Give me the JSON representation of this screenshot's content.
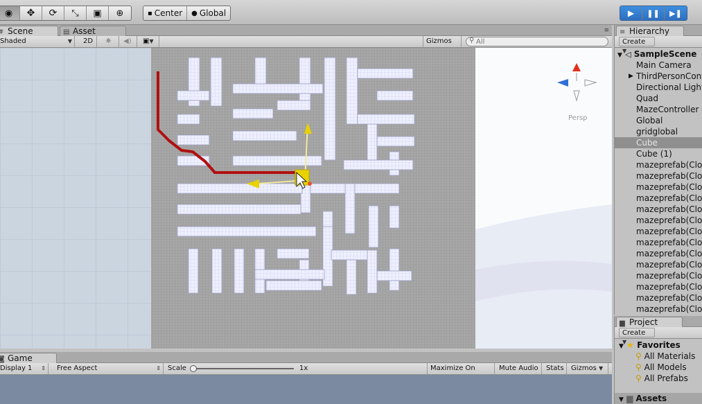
{
  "toolbar": {
    "tools": [
      {
        "name": "view-tool",
        "icon": "eye-icon",
        "glyph": "👁"
      },
      {
        "name": "move-tool",
        "icon": "move-arrows-icon",
        "glyph": "✥"
      },
      {
        "name": "rotate-tool",
        "icon": "rotate-icon",
        "glyph": "⟳"
      },
      {
        "name": "scale-tool",
        "icon": "scale-icon",
        "glyph": "⤡"
      },
      {
        "name": "rect-tool",
        "icon": "rect-icon",
        "glyph": "▣"
      },
      {
        "name": "transform-tool",
        "icon": "transform-icon",
        "glyph": "⊕"
      }
    ],
    "pivot_label": "Center",
    "space_label": "Global",
    "play_controls": {
      "play": "▶",
      "pause": "⏸",
      "step": "⏭"
    }
  },
  "scene": {
    "tab_label": "Scene",
    "asset_store_tab_label": "Asset Store",
    "shading_mode": "Shaded",
    "mode_2d_label": "2D",
    "gizmos_label": "Gizmos",
    "search_placeholder": "All",
    "gizmo_projection_label": "Persp"
  },
  "hierarchy": {
    "tab_label": "Hierarchy",
    "create_label": "Create",
    "scene_name": "SampleScene",
    "items": [
      {
        "label": "Main Camera",
        "selected": false,
        "expandable": false
      },
      {
        "label": "ThirdPersonController",
        "selected": false,
        "expandable": true
      },
      {
        "label": "Directional Light",
        "selected": false,
        "expandable": false
      },
      {
        "label": "Quad",
        "selected": false,
        "expandable": false
      },
      {
        "label": "MazeController",
        "selected": false,
        "expandable": false
      },
      {
        "label": "Global",
        "selected": false,
        "expandable": false
      },
      {
        "label": "gridglobal",
        "selected": false,
        "expandable": false
      },
      {
        "label": "Cube",
        "selected": true,
        "expandable": false
      },
      {
        "label": "Cube (1)",
        "selected": false,
        "expandable": false
      },
      {
        "label": "mazeprefab(Clone)",
        "selected": false,
        "expandable": false
      },
      {
        "label": "mazeprefab(Clone)",
        "selected": false,
        "expandable": false
      },
      {
        "label": "mazeprefab(Clone)",
        "selected": false,
        "expandable": false
      },
      {
        "label": "mazeprefab(Clone)",
        "selected": false,
        "expandable": false
      },
      {
        "label": "mazeprefab(Clone)",
        "selected": false,
        "expandable": false
      },
      {
        "label": "mazeprefab(Clone)",
        "selected": false,
        "expandable": false
      },
      {
        "label": "mazeprefab(Clone)",
        "selected": false,
        "expandable": false
      },
      {
        "label": "mazeprefab(Clone)",
        "selected": false,
        "expandable": false
      },
      {
        "label": "mazeprefab(Clone)",
        "selected": false,
        "expandable": false
      },
      {
        "label": "mazeprefab(Clone)",
        "selected": false,
        "expandable": false
      },
      {
        "label": "mazeprefab(Clone)",
        "selected": false,
        "expandable": false
      },
      {
        "label": "mazeprefab(Clone)",
        "selected": false,
        "expandable": false
      },
      {
        "label": "mazeprefab(Clone)",
        "selected": false,
        "expandable": false
      },
      {
        "label": "mazeprefab(Clone)",
        "selected": false,
        "expandable": false
      }
    ]
  },
  "game": {
    "tab_label": "Game",
    "display_label": "Display 1",
    "aspect_label": "Free Aspect",
    "scale_label": "Scale",
    "scale_value": "1x",
    "maximize_label": "Maximize On Play",
    "mute_label": "Mute Audio",
    "stats_label": "Stats",
    "gizmos_label": "Gizmos"
  },
  "project": {
    "tab_label": "Project",
    "create_label": "Create",
    "favorites_label": "Favorites",
    "favorites": [
      "All Materials",
      "All Models",
      "All Prefabs"
    ],
    "assets_label": "Assets"
  },
  "colors": {
    "accent_play": "#2d6fc0",
    "selection": "#8f8f8f",
    "path_line": "#b01010",
    "gizmo_yellow": "#e8d200",
    "panel_bg": "#c2c2c2"
  }
}
